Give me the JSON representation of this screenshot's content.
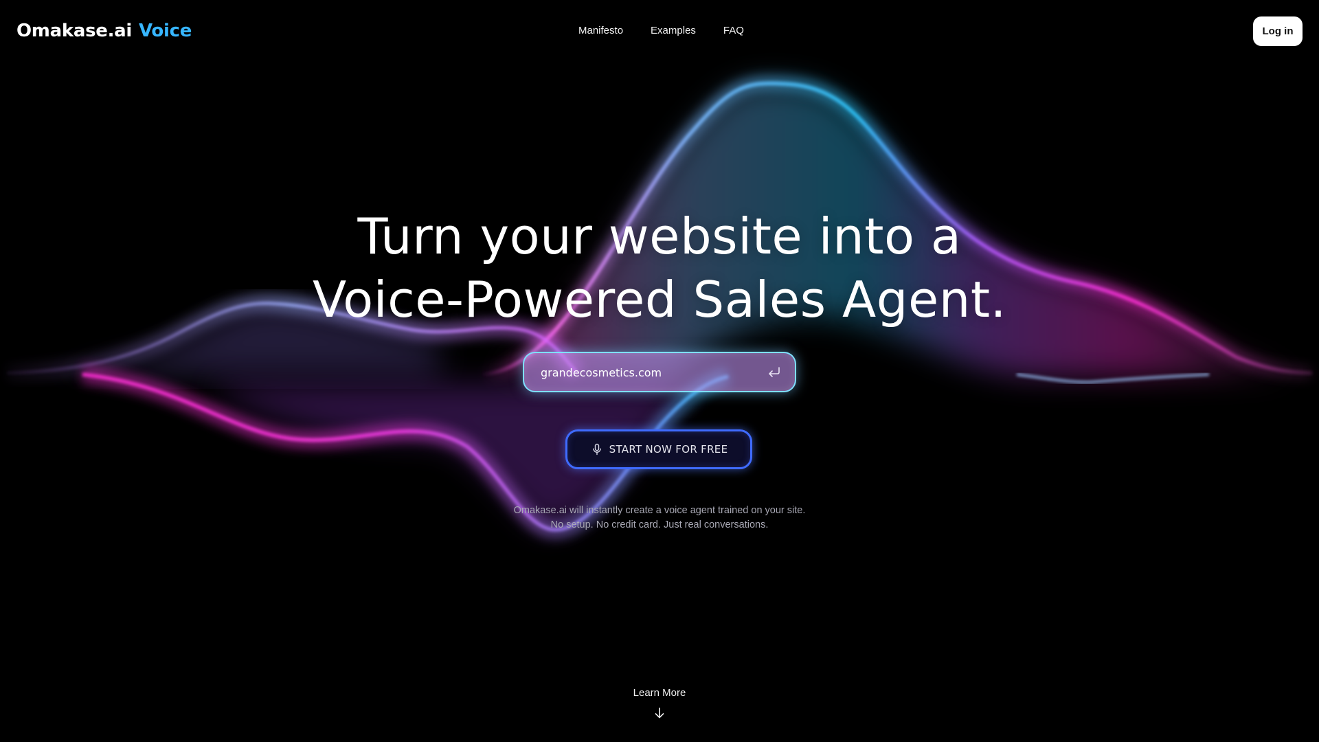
{
  "header": {
    "brand": "Omakase.ai",
    "product": "Voice",
    "nav": [
      {
        "label": "Manifesto"
      },
      {
        "label": "Examples"
      },
      {
        "label": "FAQ"
      }
    ],
    "login_label": "Log in"
  },
  "hero": {
    "title_line1": "Turn your website into a",
    "title_line2": "Voice-Powered Sales Agent.",
    "input_value": "grandecosmetics.com",
    "input_icon": "enter-return-icon",
    "cta_label": "START NOW FOR FREE",
    "cta_icon": "microphone-icon",
    "subtext_line1": "Omakase.ai will instantly create a voice agent trained on your site.",
    "subtext_line2": "No setup. No credit card. Just real conversations."
  },
  "footer": {
    "learn_more": "Learn More",
    "learn_icon": "arrow-down-icon"
  },
  "colors": {
    "background": "#000000",
    "brand_accent": "#37b6ff",
    "wave_cyan": "#2ec8ff",
    "wave_magenta": "#ff2fd6",
    "wave_violet": "#a36bff",
    "cta_border": "#3f6bff"
  }
}
